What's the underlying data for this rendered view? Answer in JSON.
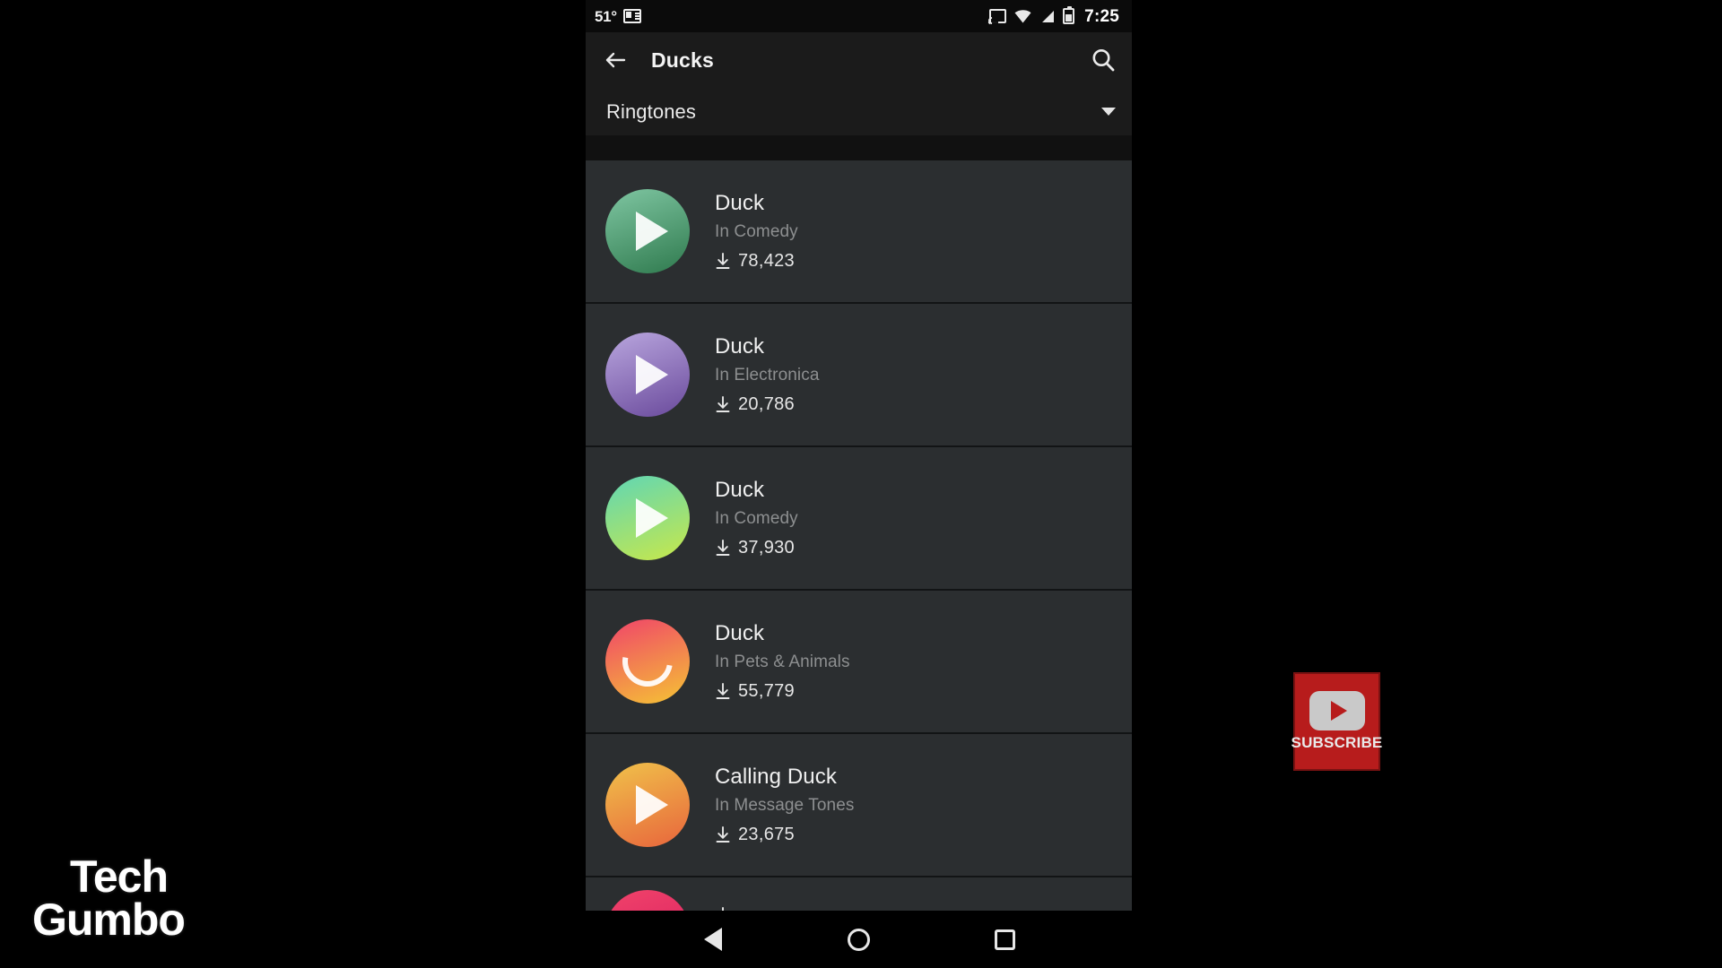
{
  "status_bar": {
    "temperature": "51°",
    "news_icon": "news-widget-icon",
    "cast_icon": "cast-icon",
    "wifi_icon": "wifi-icon",
    "signal_icon": "cell-signal-icon",
    "battery_icon": "battery-icon",
    "time": "7:25"
  },
  "app_bar": {
    "back_icon": "back-arrow-icon",
    "title": "Ducks",
    "search_icon": "search-icon"
  },
  "category_selector": {
    "label": "Ringtones",
    "caret_icon": "chevron-down-icon"
  },
  "list": {
    "download_icon": "download-icon",
    "items": [
      {
        "title": "Duck",
        "subtitle": "In Comedy",
        "downloads": "78,423",
        "thumb_state": "play",
        "thumb_colors": [
          "#7fc6a2",
          "#2f7a4e"
        ]
      },
      {
        "title": "Duck",
        "subtitle": "In Electronica",
        "downloads": "20,786",
        "thumb_state": "play",
        "thumb_colors": [
          "#b9a6de",
          "#6a4a9c"
        ]
      },
      {
        "title": "Duck",
        "subtitle": "In Comedy",
        "downloads": "37,930",
        "thumb_state": "play",
        "thumb_colors": [
          "#5fd6b5",
          "#c8e84a"
        ]
      },
      {
        "title": "Duck",
        "subtitle": "In Pets & Animals",
        "downloads": "55,779",
        "thumb_state": "loading",
        "thumb_colors": [
          "#f0436a",
          "#f5c434"
        ]
      },
      {
        "title": "Calling Duck",
        "subtitle": "In Message Tones",
        "downloads": "23,675",
        "thumb_state": "play",
        "thumb_colors": [
          "#f0c24a",
          "#e8653c"
        ]
      },
      {
        "title": "",
        "subtitle": "",
        "downloads": "",
        "thumb_state": "play",
        "thumb_colors": [
          "#f0436a",
          "#d81b60"
        ]
      }
    ]
  },
  "nav_bar": {
    "back_icon": "nav-back-icon",
    "home_icon": "nav-home-icon",
    "recents_icon": "nav-recents-icon"
  },
  "watermark": {
    "line1": "Tech",
    "line2": "Gumbo"
  },
  "subscribe_overlay": {
    "logo_icon": "youtube-logo-icon",
    "label": "SUBSCRIBE",
    "brand_color": "#b71c1c"
  }
}
